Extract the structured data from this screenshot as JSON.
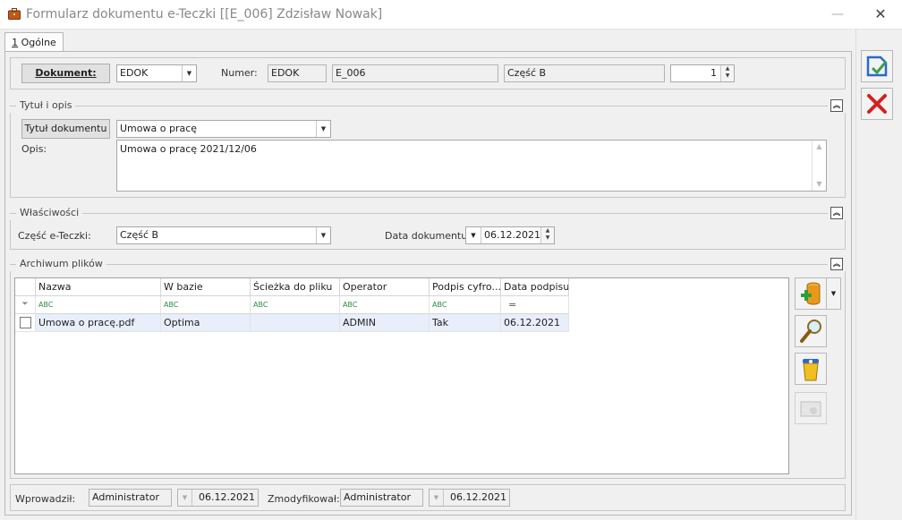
{
  "window": {
    "title": "Formularz dokumentu e-Teczki [[E_006] Zdzisław Nowak]",
    "minimize": "—",
    "close": "✕"
  },
  "tab": {
    "label_u": "1",
    "label_rest": " Ogólne"
  },
  "doc": {
    "dokument_btn": "Dokument:",
    "dokument_value": "EDOK",
    "numer_label": "Numer:",
    "numer_prefix": "EDOK",
    "numer_value": "E_006",
    "czesc_value": "Część B",
    "seq_value": "1"
  },
  "tytul": {
    "group_label": "Tytuł i opis",
    "btn": "Tytuł dokumentu",
    "value": "Umowa o pracę",
    "opis_label": "Opis:",
    "opis_value": "Umowa o pracę 2021/12/06"
  },
  "wlasc": {
    "group_label": "Właściwości",
    "czesc_label": "Część e-Teczki:",
    "czesc_value": "Część B",
    "data_label": "Data dokumentu:",
    "data_value": "06.12.2021"
  },
  "archiwum": {
    "group_label": "Archiwum plików",
    "columns": [
      "Nazwa",
      "W bazie",
      "Ścieżka do pliku",
      "Operator",
      "Podpis cyfro...",
      "Data podpisu"
    ],
    "filter_glyph": "ABC",
    "filter_eq": "=",
    "rows": [
      {
        "nazwa": "Umowa o pracę.pdf",
        "w_bazie": "Optima",
        "sciezka": "",
        "operator": "ADMIN",
        "podpis": "Tak",
        "data": "06.12.2021"
      }
    ]
  },
  "footer": {
    "wprowadzil_label": "Wprowadził:",
    "wprowadzil_value": "Administrator",
    "wprowadzil_date": "06.12.2021",
    "zmodyfikowal_label": "Zmodyfikował:",
    "zmodyfikowal_value": "Administrator",
    "zmodyfikowal_date": "06.12.2021"
  },
  "colors": {
    "accent_blue": "#2a6ac8",
    "cancel_red": "#d42020",
    "selection": "#e8eefa"
  }
}
